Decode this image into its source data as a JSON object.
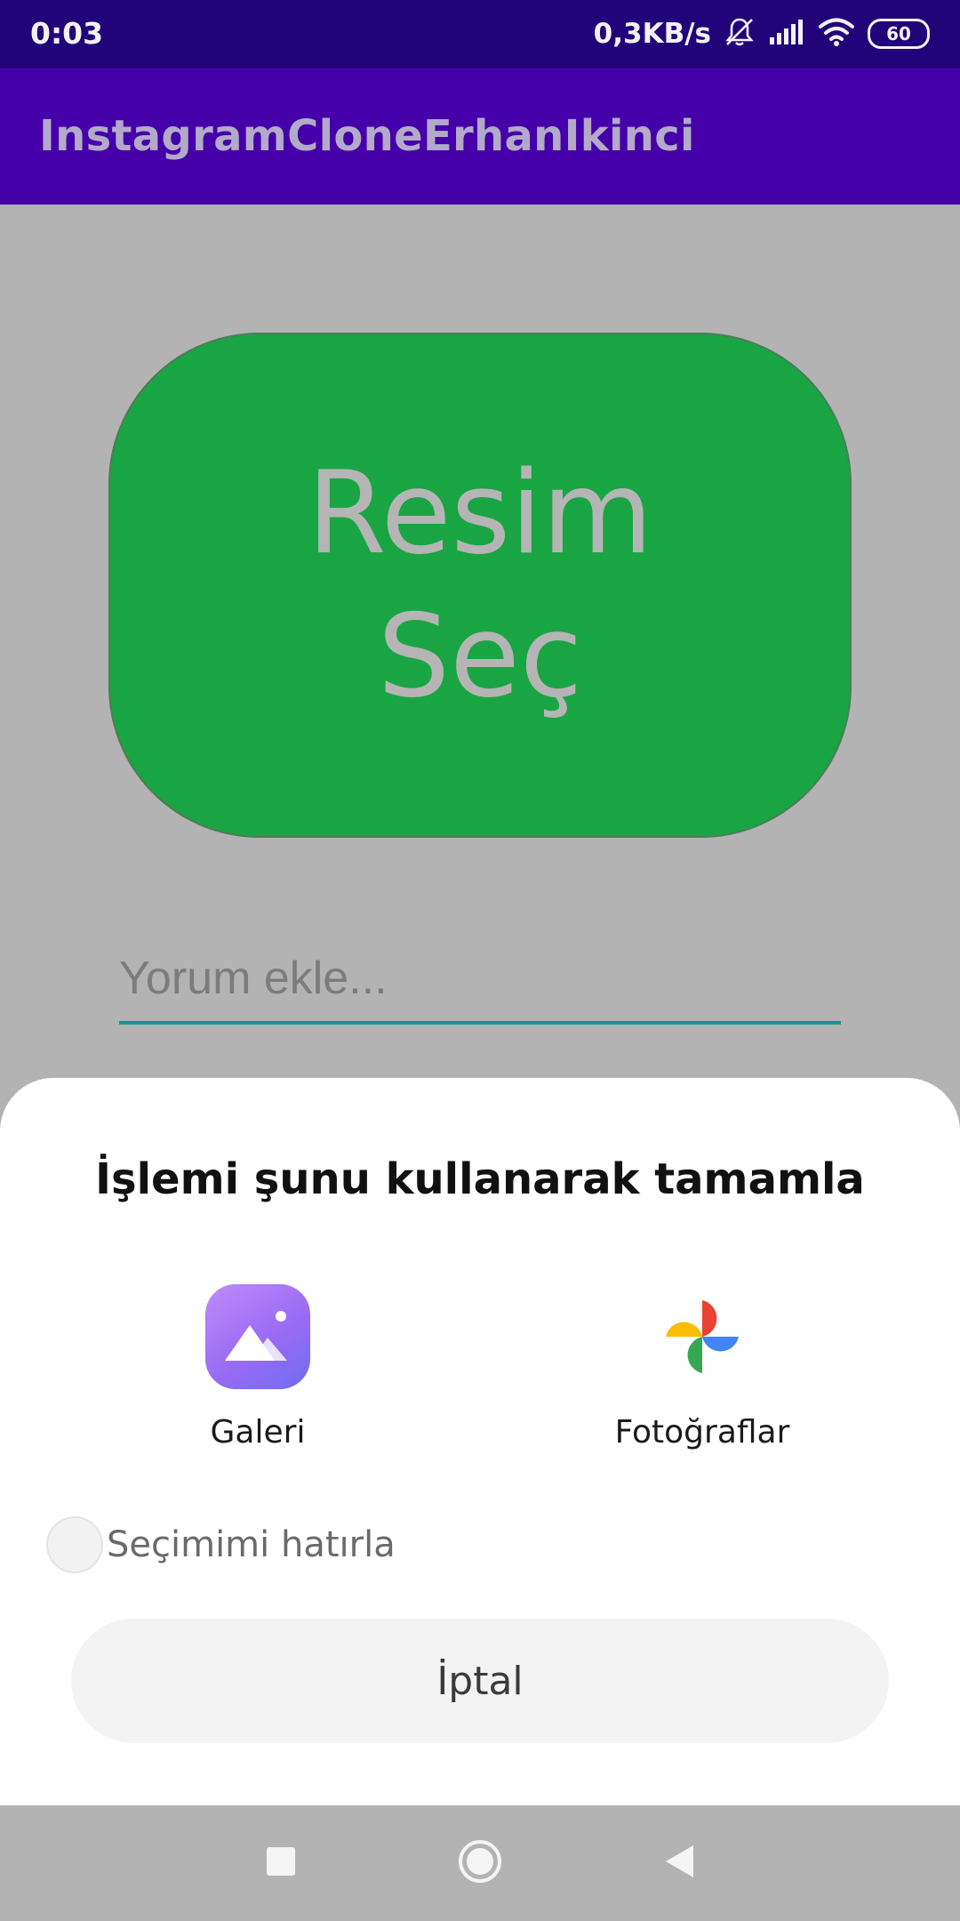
{
  "status_bar": {
    "time": "0:03",
    "network_speed": "0,3KB/s",
    "battery_level": "60"
  },
  "app_bar": {
    "title": "InstagramCloneErhanIkinci"
  },
  "main": {
    "pick_image_label": "Resim Seç",
    "comment_placeholder": "Yorum ekle..."
  },
  "sheet": {
    "title": "İşlemi şunu kullanarak tamamla",
    "apps": [
      {
        "label": "Galeri",
        "icon": "gallery-icon"
      },
      {
        "label": "Fotoğraflar",
        "icon": "google-photos-icon"
      }
    ],
    "remember_label": "Seçimimi hatırla",
    "cancel_label": "İptal"
  },
  "colors": {
    "status_bar": "#22047a",
    "app_bar": "#4600a9",
    "pick_button": "#19a543",
    "input_underline": "#189494",
    "scrim": "#b3b3b3",
    "sheet": "#ffffff"
  }
}
